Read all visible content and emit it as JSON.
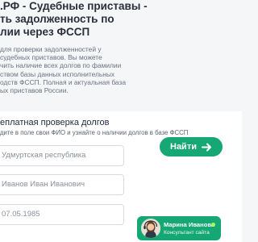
{
  "header": {
    "title_line1": ".РФ - Судебные приставы -",
    "title_line2": "ть задолженность по",
    "title_line3": "лии через ФССП"
  },
  "description": {
    "line1": "для проверки задолженностей у",
    "line2": "судебных приставов. Вы можете",
    "line3": "чить наличие всех долгов по фамилии",
    "line4": "ством базы данных исполнительных",
    "line5": "одств ФССП. Полная и актуальная база",
    "line6": "ых приставов России."
  },
  "form": {
    "title": "еплатная проверка долгов",
    "subtitle": "дите в поле свои ФИО и узнайте о наличии долгов в базе ФССП",
    "region_value": "Удмуртская республика",
    "name_value": "Иванов Иван Иванович",
    "date_value": "07.05.1985",
    "submit_label": "Найти",
    "submit_icon": "arrow-right-icon",
    "accent_color": "#16a874"
  },
  "chat": {
    "name": "Марина Иванова",
    "role": "Консультант сайта",
    "status_color": "#a8ff5a"
  }
}
